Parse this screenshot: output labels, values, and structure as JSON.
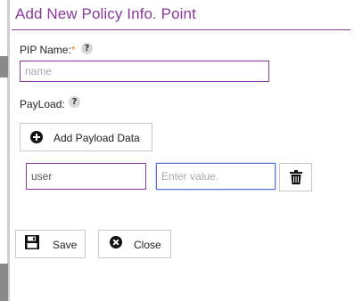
{
  "dialog": {
    "title": "Add New Policy Info. Point"
  },
  "pip_name": {
    "label": "PIP Name:",
    "required_marker": "*",
    "help": "?",
    "placeholder": "name",
    "value": ""
  },
  "payload": {
    "label": "PayLoad:",
    "help": "?",
    "add_button_label": "Add Payload Data",
    "rows": [
      {
        "key": "user",
        "value": "",
        "value_placeholder": "Enter value."
      }
    ]
  },
  "actions": {
    "save_label": "Save",
    "close_label": "Close"
  },
  "colors": {
    "accent": "#8b3a9c",
    "focus": "#5a6fd6",
    "required": "#e08a1e"
  }
}
